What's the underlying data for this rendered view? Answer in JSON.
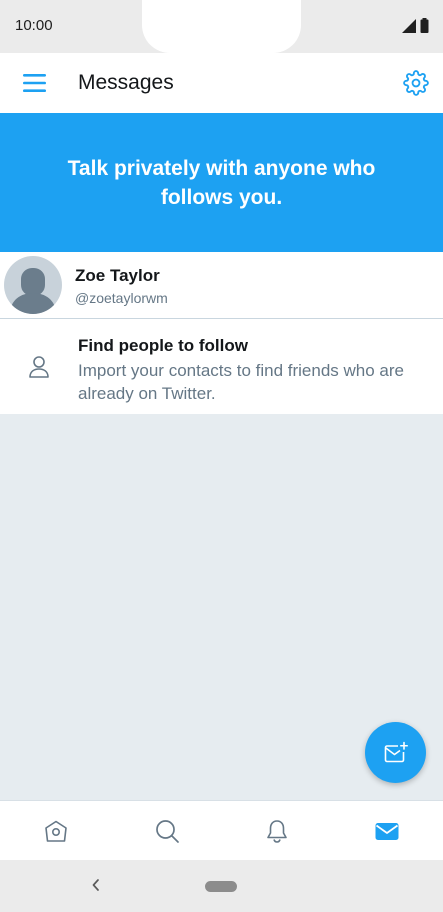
{
  "status_bar": {
    "time": "10:00"
  },
  "app_bar": {
    "title": "Messages"
  },
  "banner": {
    "text": "Talk privately with anyone who follows you."
  },
  "account": {
    "name": "Zoe Taylor",
    "handle": "@zoetaylorwm"
  },
  "find_people": {
    "title": "Find people to follow",
    "description": "Import your contacts to find friends who are already on Twitter."
  },
  "icons": {
    "menu": "hamburger-menu-icon",
    "settings": "gear-icon",
    "person": "person-icon",
    "compose": "new-message-icon",
    "home": "home-icon",
    "search": "search-icon",
    "notifications": "bell-icon",
    "messages": "envelope-icon"
  },
  "colors": {
    "brand": "#1da1f2",
    "background": "#e6ecf0",
    "text_primary": "#14171a",
    "text_secondary": "#657786",
    "tab_inactive": "#657786"
  },
  "tabs": {
    "active": "messages"
  }
}
